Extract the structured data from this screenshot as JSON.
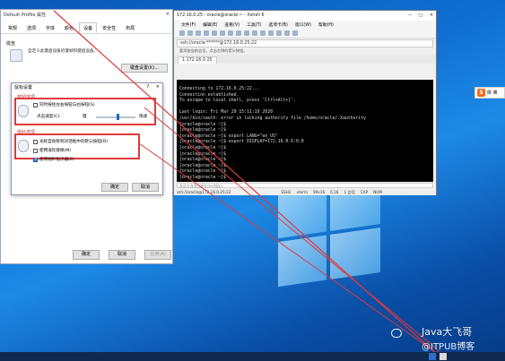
{
  "profile_window": {
    "title": "Default Profile 属性",
    "tabs": [
      "常规",
      "选项",
      "字体",
      "颜色",
      "设备",
      "安全性",
      "布局"
    ],
    "keyboard_group": {
      "legend": "键盘",
      "desc": "自定义此键盘设备的键帧和键盘设备。",
      "button": "键盘设置(K)..."
    },
    "buttons": {
      "ok": "确定",
      "cancel": "取消",
      "apply": "应用(A)"
    }
  },
  "mouse_dialog": {
    "title": "鼠标设置",
    "close": "×",
    "help": "?",
    "button_section": {
      "label": "按钮选项",
      "swap_label": "同时按住左右按钮与右按钮(S)",
      "speed_label": "点击速度(C):",
      "slow": "慢",
      "fast": "快速",
      "speed_value": 0.55
    },
    "pointer_section": {
      "label": "指针选项",
      "item1": "光标自动移到对话框中的默认按钮(D)",
      "item2": "使用滚轮替换(M)",
      "item3": "使用指针指示器(E)"
    },
    "buttons": {
      "ok": "确定",
      "cancel": "取消"
    }
  },
  "xshell": {
    "title": "172.16.0.25 - oracle@oracle:~ - Xshell 6",
    "menu": [
      "文件(F)",
      "编辑(E)",
      "查看(V)",
      "工具(T)",
      "选项卡(B)",
      "窗口(W)",
      "帮助(H)"
    ],
    "address": "ssh://oracle:******@172.16.0.25:22",
    "hint": "要添加当前会话，点击左侧的箭头按钮。",
    "tab": "1 172.16.0.25",
    "terminal_lines": [
      "Connecting to 172.16.0.25:22...",
      "Connection established.",
      "To escape to local shell, press 'Ctrl+Alt+]'.",
      "",
      "Last login: Fri Mar 20 15:11:19 2020",
      "/usr/bin/xauth:  error in locking authority file /home/oracle/.Xauthority",
      "[oracle@oracle ~]$",
      "[oracle@oracle ~]$",
      "[oracle@oracle ~]$ export LANG=\"en_US\"",
      "[oracle@oracle ~]$ export DISPLAY=172.16.0.6:0.0",
      "[oracle@oracle ~]$",
      "[oracle@oracle ~]$",
      "[oracle@oracle ~]$",
      "[oracle@oracle ~]$",
      "[oracle@oracle ~]$",
      "[oracle@oracle ~]$"
    ],
    "input_placeholder": "发送文本到当前Xshell窗口",
    "status": {
      "left": "ssh://oracle@172.16.0.25:22",
      "proto": "SSH2",
      "term": "xterm",
      "size": "99x16",
      "pos": "6,16",
      "sessions": "1 会话",
      "caps": "CAP",
      "num": "NUM"
    }
  },
  "ime": {
    "logo": "S",
    "text": "拼 英"
  },
  "watermark": {
    "line1": "Java大飞哥",
    "line2": "@ITPUB博客"
  },
  "colors": {
    "annotation_red": "#e03a3a",
    "desktop_blue": "#0f6fd2",
    "terminal_bg": "#000000",
    "ime_orange": "#f26b1d"
  }
}
